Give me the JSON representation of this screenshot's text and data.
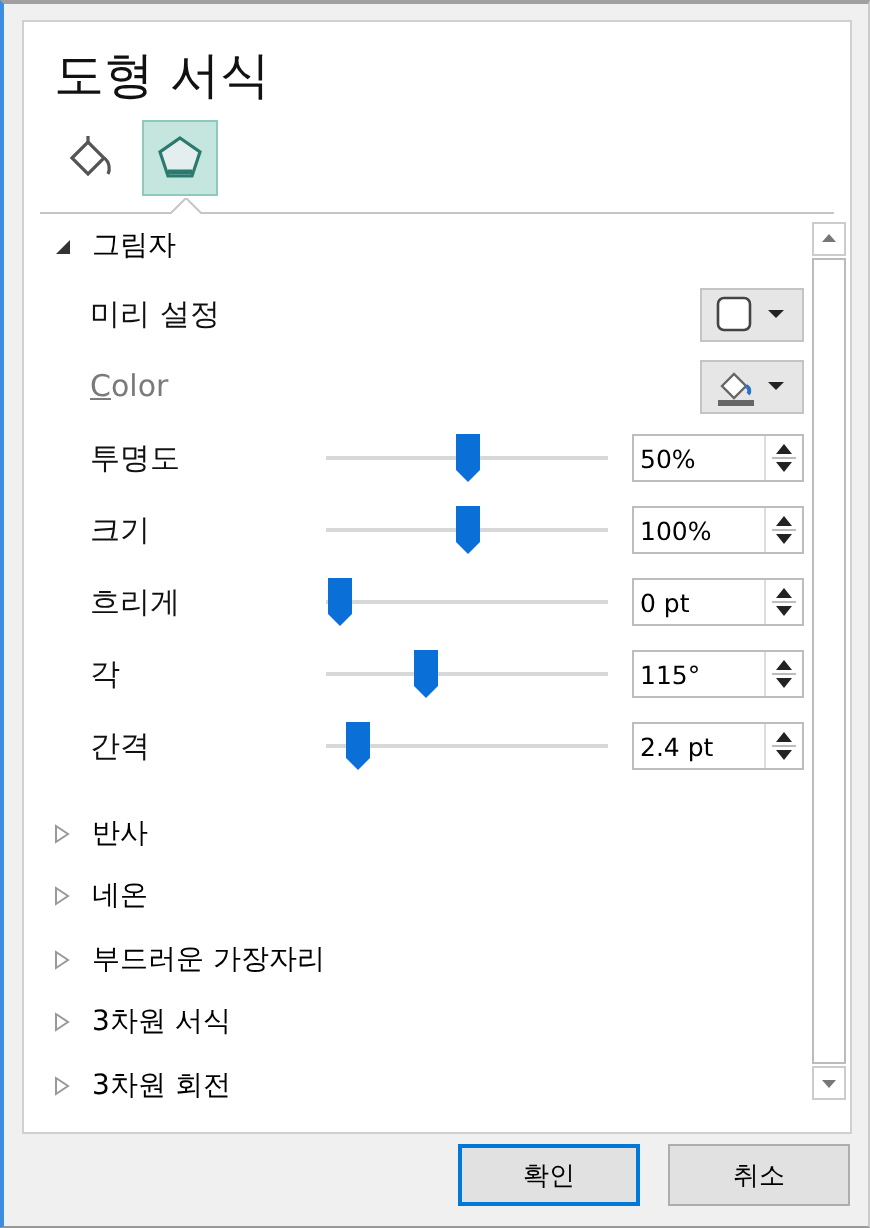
{
  "panel": {
    "title": "도형 서식"
  },
  "tabs": [
    {
      "kind": "fill",
      "selected": false
    },
    {
      "kind": "effects",
      "selected": true
    }
  ],
  "shadow": {
    "label": "그림자",
    "expanded": true,
    "preset": {
      "label": "미리 설정"
    },
    "color": {
      "label": "Color",
      "disabled": true
    },
    "sliders": [
      {
        "label": "투명도",
        "level": 0.5,
        "value": "50%"
      },
      {
        "label": "크기",
        "level": 0.5,
        "value": "100%"
      },
      {
        "label": "흐리게",
        "level": 0,
        "value": "0 pt"
      },
      {
        "label": "각",
        "level": 0.34,
        "value": "115°"
      },
      {
        "label": "간격",
        "level": 0.07,
        "value": "2.4 pt"
      }
    ]
  },
  "sections": [
    {
      "label": "반사",
      "expanded": false
    },
    {
      "label": "네온",
      "expanded": false
    },
    {
      "label": "부드러운 가장자리",
      "expanded": false
    },
    {
      "label": "3차원 서식",
      "expanded": false
    },
    {
      "label": "3차원 회전",
      "expanded": false
    }
  ],
  "buttons": [
    {
      "label": "확인",
      "default": true
    },
    {
      "label": "취소",
      "default": false
    }
  ]
}
